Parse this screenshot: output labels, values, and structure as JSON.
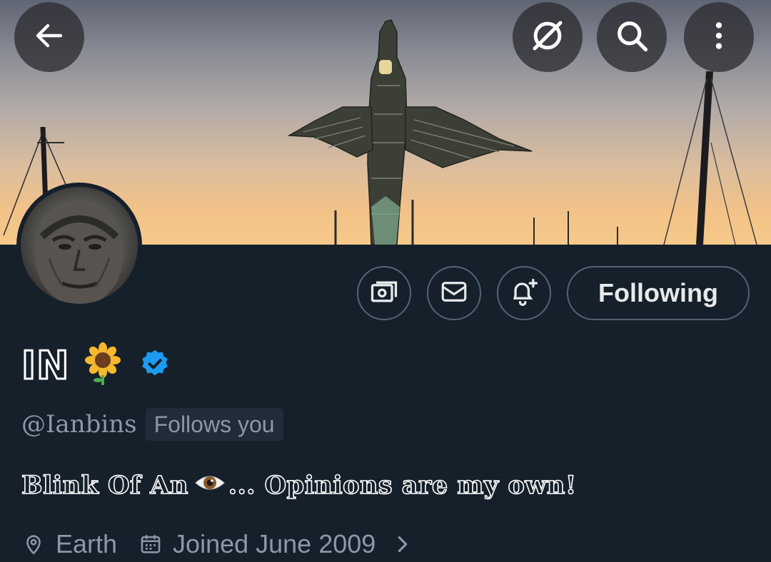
{
  "header": {
    "back_icon": "arrow-left-icon",
    "grok_icon": "grok-icon",
    "search_icon": "search-icon",
    "more_icon": "more-vertical-icon"
  },
  "profile": {
    "display_name": "IN",
    "name_emoji": "🌻",
    "verified": true,
    "handle": "@Ianbins",
    "follows_you": "Follows you",
    "bio_prefix": "Blink Of An",
    "bio_emoji": "👁️",
    "bio_suffix": "... Opinions are my own!",
    "location": "Earth",
    "joined": "Joined June 2009"
  },
  "actions": {
    "tip_icon": "money-icon",
    "message_icon": "envelope-icon",
    "notify_icon": "bell-plus-icon",
    "follow_label": "Following"
  },
  "colors": {
    "background": "#15202b",
    "verified_blue": "#1d9bf0",
    "muted_text": "#8b98a5",
    "border": "#536471"
  }
}
